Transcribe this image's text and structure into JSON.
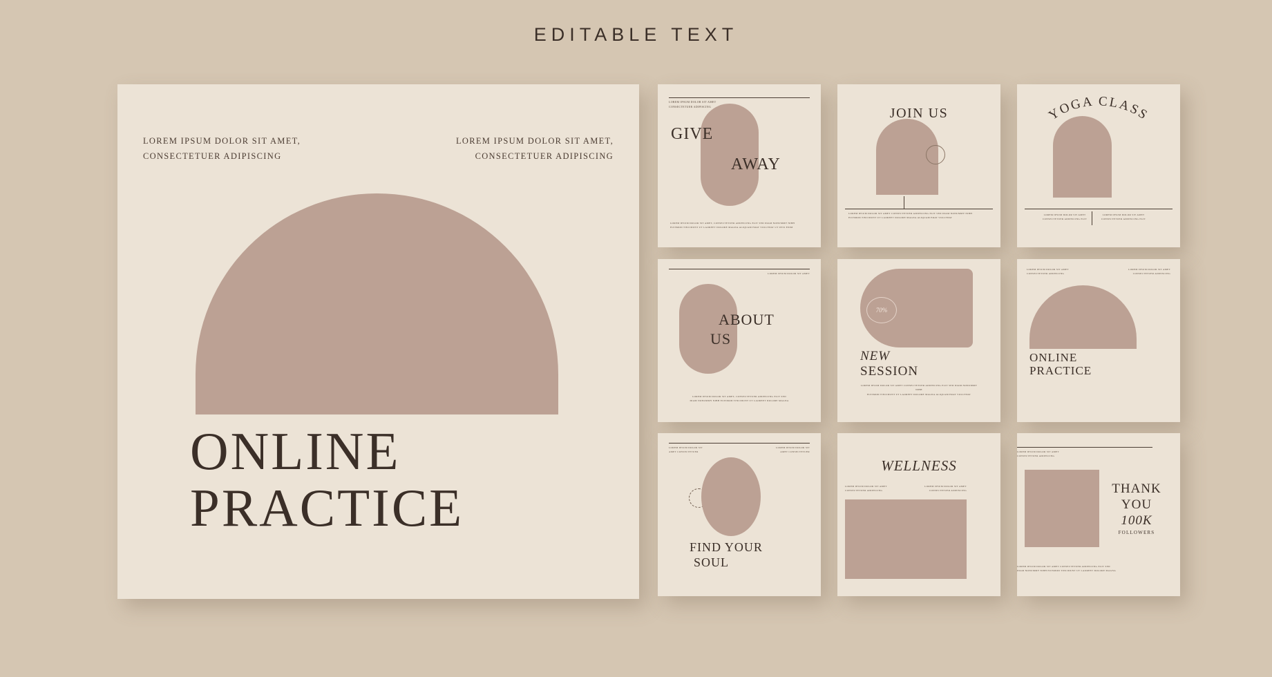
{
  "header": {
    "title": "EDITABLE TEXT"
  },
  "colors": {
    "page_background": "#d5c6b2",
    "card_background": "#ece3d6",
    "accent_mauve": "#bca194",
    "ink": "#3b2f28"
  },
  "hero": {
    "kicker_left": "LOREM IPSUM DOLOR SIT AMET,\nCONSECTETUER ADIPISCING",
    "kicker_left_line1": "LOREM IPSUM DOLOR SIT AMET,",
    "kicker_left_line2": "CONSECTETUER ADIPISCING",
    "kicker_right_line1": "LOREM IPSUM DOLOR SIT AMET,",
    "kicker_right_line2": "CONSECTETUER ADIPISCING",
    "title_line1": "ONLINE",
    "title_line2": "PRACTICE"
  },
  "cards": [
    {
      "id": "give-away",
      "headline_1": "GIVE",
      "headline_2": "AWAY",
      "top_note_line1": "LOREM IPSUM DOLOR SIT AMET",
      "top_note_line2": "CONSECTETUER ADIPISCING",
      "bottom_note_line1": "LOREM IPSUM DOLOR SIT AMET, CONSECTETUER ADIPISCING ELIT SED DIAM NONUMMY NIBH",
      "bottom_note_line2": "EUISMOD TINCIDUNT UT LAOREET DOLORE MAGNA ALIQUAM ERAT VOLUTPAT UT WISI ENIM"
    },
    {
      "id": "join-us",
      "headline_1": "JOIN US",
      "bottom_note_line1": "LOREM IPSUM DOLOR SIT AMET CONSECTETUER ADIPISCING ELIT SED DIAM NONUMMY NIBH",
      "bottom_note_line2": "EUISMOD TINCIDUNT UT LAOREET DOLORE MAGNA ALIQUAM ERAT VOLUTPAT"
    },
    {
      "id": "yoga-class",
      "headline_1": "YOGA CLASS",
      "bottom_note_left_line1": "LOREM IPSUM DOLOR SIT AMET",
      "bottom_note_left_line2": "CONSECTETUER ADIPISCING ELIT",
      "bottom_note_right_line1": "LOREM IPSUM DOLOR SIT AMET",
      "bottom_note_right_line2": "CONSECTETUER ADIPISCING ELIT"
    },
    {
      "id": "about-us",
      "headline_1": "ABOUT",
      "headline_2": "US",
      "top_note_line1": "LOREM IPSUM DOLOR SIT AMET",
      "bottom_note_line1": "LOREM IPSUM DOLOR SIT AMET, CONSECTETUER ADIPISCING ELIT SED",
      "bottom_note_line2": "DIAM NONUMMY NIBH EUISMOD TINCIDUNT UT LAOREET DOLORE MAGNA"
    },
    {
      "id": "new-session",
      "headline_1": "NEW",
      "headline_2": "SESSION",
      "badge_value": "70%",
      "bottom_note_line1": "LOREM IPSUM DOLOR SIT AMET CONSECTETUER ADIPISCING ELIT SED DIAM NONUMMY NIBH",
      "bottom_note_line2": "EUISMOD TINCIDUNT UT LAOREET DOLORE MAGNA ALIQUAM ERAT VOLUTPAT"
    },
    {
      "id": "online-practice",
      "headline_1": "ONLINE",
      "headline_2": "PRACTICE",
      "top_note_left_line1": "LOREM IPSUM DOLOR SIT AMET",
      "top_note_left_line2": "CONSECTETUER ADIPISCING",
      "top_note_right_line1": "LOREM IPSUM DOLOR SIT AMET",
      "top_note_right_line2": "CONSECTETUER ADIPISCING"
    },
    {
      "id": "find-your-soul",
      "headline_1": "FIND YOUR",
      "headline_2": "SOUL",
      "top_note_left_line1": "LOREM IPSUM DOLOR SIT",
      "top_note_left_line2": "AMET CONSECTETUER",
      "top_note_right_line1": "LOREM IPSUM DOLOR SIT",
      "top_note_right_line2": "AMET CONSECTETUER",
      "circle_accent": "dashed-ring"
    },
    {
      "id": "wellness",
      "headline_1": "WELLNESS",
      "note_left_line1": "LOREM IPSUM DOLOR SIT AMET",
      "note_left_line2": "CONSECTETUER ADIPISCING",
      "note_right_line1": "LOREM IPSUM DOLOR SIT AMET",
      "note_right_line2": "CONSECTETUER ADIPISCING"
    },
    {
      "id": "thank-you",
      "headline_1": "THANK",
      "headline_2": "YOU",
      "headline_3": "100K",
      "subline": "FOLLOWERS",
      "top_note_line1": "LOREM IPSUM DOLOR SIT AMET",
      "top_note_line2": "CONSECTETUER ADIPISCING",
      "bottom_note_line1": "LOREM IPSUM DOLOR SIT AMET CONSECTETUER ADIPISCING ELIT SED",
      "bottom_note_line2": "DIAM NONUMMY NIBH EUISMOD TINCIDUNT UT LAOREET DOLORE MAGNA"
    }
  ]
}
